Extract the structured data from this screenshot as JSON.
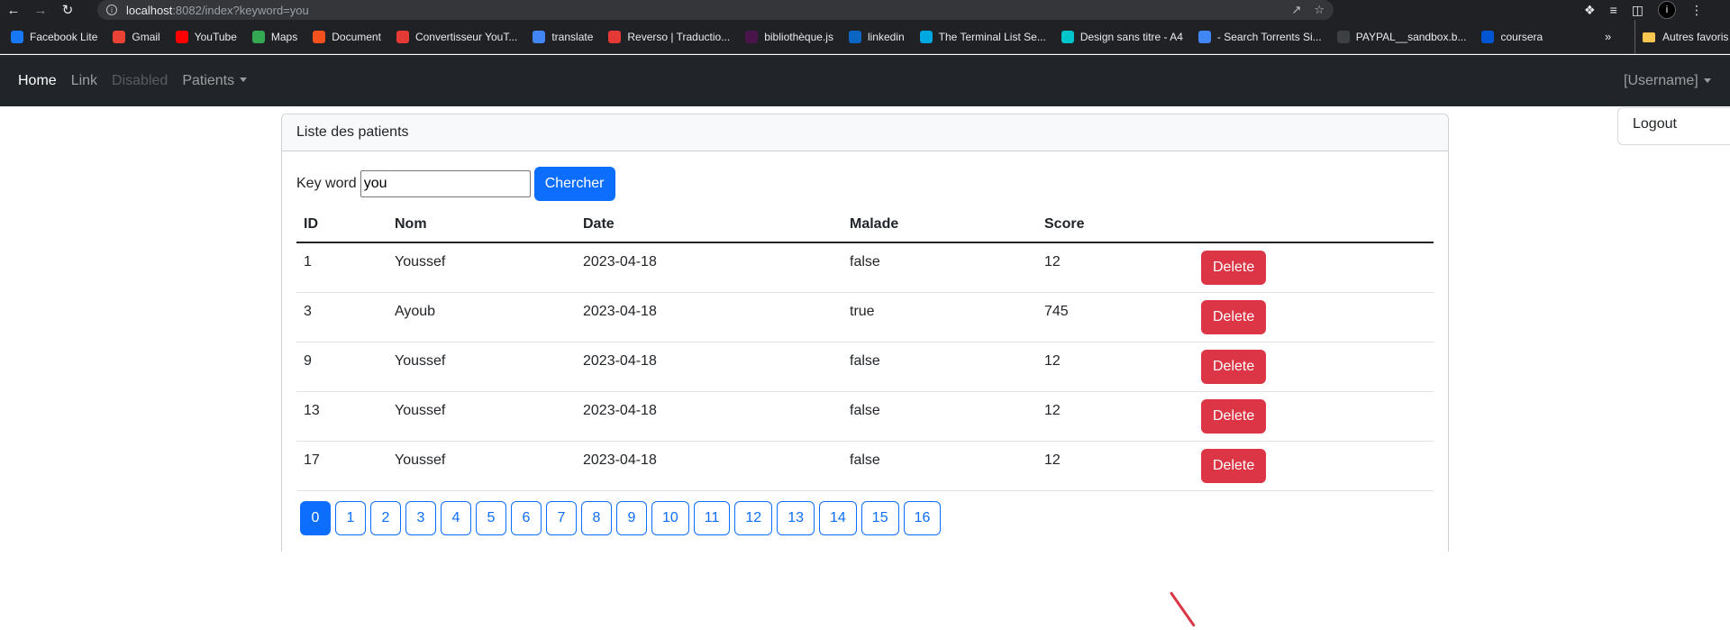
{
  "browser": {
    "url_host": "localhost",
    "url_rest": ":8082/index?keyword=you",
    "bookmarks": [
      {
        "label": "Facebook Lite",
        "icon": "facebook-icon",
        "color": "#1877f2"
      },
      {
        "label": "Gmail",
        "icon": "gmail-icon",
        "color": "#ea4335"
      },
      {
        "label": "YouTube",
        "icon": "youtube-icon",
        "color": "#ff0000"
      },
      {
        "label": "Maps",
        "icon": "maps-icon",
        "color": "#34a853"
      },
      {
        "label": "Document",
        "icon": "document-icon",
        "color": "#f4511e"
      },
      {
        "label": "Convertisseur YouT...",
        "icon": "youtube-converter-icon",
        "color": "#e53935"
      },
      {
        "label": "translate",
        "icon": "google-translate-icon",
        "color": "#4285f4"
      },
      {
        "label": "Reverso | Traductio...",
        "icon": "reverso-icon",
        "color": "#e53935"
      },
      {
        "label": "bibliothèque.js",
        "icon": "library-icon",
        "color": "#4a154b"
      },
      {
        "label": "linkedin",
        "icon": "linkedin-icon",
        "color": "#0a66c2"
      },
      {
        "label": "The Terminal List Se...",
        "icon": "prime-video-icon",
        "color": "#00a8e1"
      },
      {
        "label": "Design sans titre - A4",
        "icon": "canva-icon",
        "color": "#00c4cc"
      },
      {
        "label": "- Search Torrents Si...",
        "icon": "torrent-search-icon",
        "color": "#4285f4"
      },
      {
        "label": "PAYPAL__sandbox.b...",
        "icon": "paypal-icon",
        "color": "#3c4043"
      },
      {
        "label": "coursera",
        "icon": "coursera-icon",
        "color": "#0056d2"
      }
    ],
    "more": "»",
    "other_bookmarks": "Autres favoris"
  },
  "navbar": {
    "home": "Home",
    "link": "Link",
    "disabled": "Disabled",
    "patients": "Patients",
    "username": "[Username]",
    "logout": "Logout"
  },
  "card": {
    "header": "Liste des patients",
    "keyword_label": "Key word",
    "keyword_value": "you",
    "search_button": "Chercher"
  },
  "table": {
    "columns": [
      "ID",
      "Nom",
      "Date",
      "Malade",
      "Score",
      ""
    ],
    "delete_label": "Delete",
    "rows": [
      {
        "id": "1",
        "nom": "Youssef",
        "date": "2023-04-18",
        "malade": "false",
        "score": "12"
      },
      {
        "id": "3",
        "nom": "Ayoub",
        "date": "2023-04-18",
        "malade": "true",
        "score": "745"
      },
      {
        "id": "9",
        "nom": "Youssef",
        "date": "2023-04-18",
        "malade": "false",
        "score": "12"
      },
      {
        "id": "13",
        "nom": "Youssef",
        "date": "2023-04-18",
        "malade": "false",
        "score": "12"
      },
      {
        "id": "17",
        "nom": "Youssef",
        "date": "2023-04-18",
        "malade": "false",
        "score": "12"
      }
    ]
  },
  "pagination": {
    "pages": [
      "0",
      "1",
      "2",
      "3",
      "4",
      "5",
      "6",
      "7",
      "8",
      "9",
      "10",
      "11",
      "12",
      "13",
      "14",
      "15",
      "16"
    ],
    "current": "0"
  },
  "colors": {
    "primary": "#0d6efd",
    "danger": "#dc3545",
    "navbar_bg": "#212529"
  }
}
